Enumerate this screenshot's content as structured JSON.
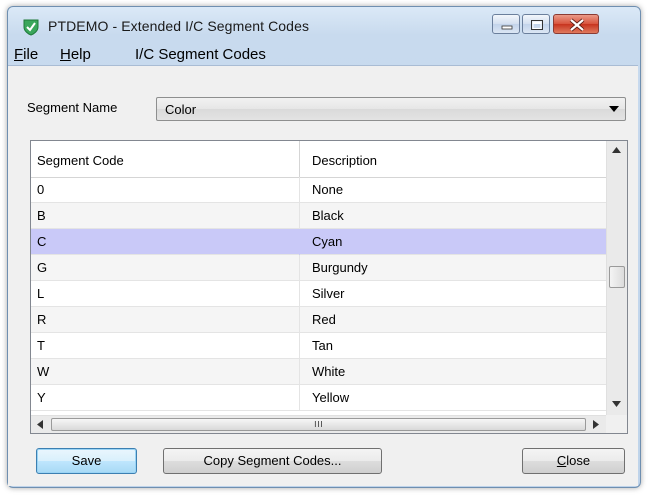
{
  "window": {
    "title": "PTDEMO - Extended I/C Segment Codes",
    "controls": {
      "minimize": "minimize-icon",
      "maximize": "maximize-icon",
      "close": "close-icon"
    }
  },
  "menu": {
    "items": [
      {
        "label": "File",
        "mnemonic": "F",
        "rest": "ile"
      },
      {
        "label": "Help",
        "mnemonic": "H",
        "rest": "elp"
      },
      {
        "label": "I/C Segment Codes",
        "mnemonic": "",
        "rest": "I/C Segment Codes"
      }
    ]
  },
  "segment": {
    "label": "Segment Name",
    "value": "Color"
  },
  "grid": {
    "columns": [
      "Segment Code",
      "Description"
    ],
    "rows": [
      {
        "code": "0",
        "description": "None"
      },
      {
        "code": "B",
        "description": "Black"
      },
      {
        "code": "C",
        "description": "Cyan"
      },
      {
        "code": "G",
        "description": "Burgundy"
      },
      {
        "code": "L",
        "description": "Silver"
      },
      {
        "code": "R",
        "description": "Red"
      },
      {
        "code": "T",
        "description": "Tan"
      },
      {
        "code": "W",
        "description": "White"
      },
      {
        "code": "Y",
        "description": "Yellow"
      }
    ],
    "selected_index": 2
  },
  "buttons": {
    "save": "Save",
    "copy": "Copy Segment Codes...",
    "close_mnemonic": "C",
    "close_rest": "lose"
  },
  "colors": {
    "selection": "#c9c9f8",
    "app_icon": "#3aa65b"
  }
}
